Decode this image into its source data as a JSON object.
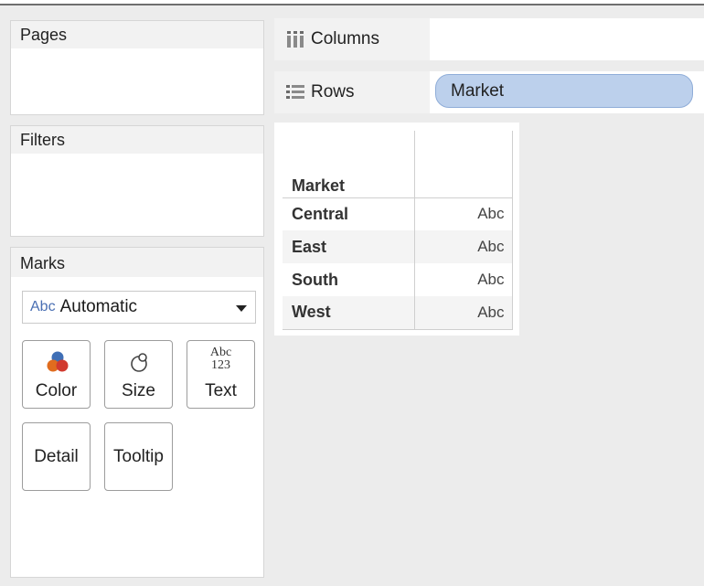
{
  "cards": {
    "pages": {
      "title": "Pages"
    },
    "filters": {
      "title": "Filters"
    },
    "marks": {
      "title": "Marks",
      "mark_type_prefix": "Abc",
      "mark_type": "Automatic",
      "buttons": {
        "color": "Color",
        "size": "Size",
        "text": "Text",
        "text_icon_top": "Abc",
        "text_icon_bottom": "123",
        "detail": "Detail",
        "tooltip": "Tooltip"
      }
    }
  },
  "shelves": {
    "columns": {
      "label": "Columns",
      "pills": []
    },
    "rows": {
      "label": "Rows",
      "pills": [
        "Market"
      ]
    }
  },
  "view": {
    "row_header": "Market",
    "rows": [
      {
        "market": "Central",
        "mark": "Abc"
      },
      {
        "market": "East",
        "mark": "Abc"
      },
      {
        "market": "South",
        "mark": "Abc"
      },
      {
        "market": "West",
        "mark": "Abc"
      }
    ]
  },
  "colors": {
    "pill_fill": "#bcd0ec",
    "pill_border": "#8fadd8",
    "color_icon_blue": "#3f6fb6",
    "color_icon_orange": "#e06c1e",
    "color_icon_red": "#d13a2f"
  }
}
